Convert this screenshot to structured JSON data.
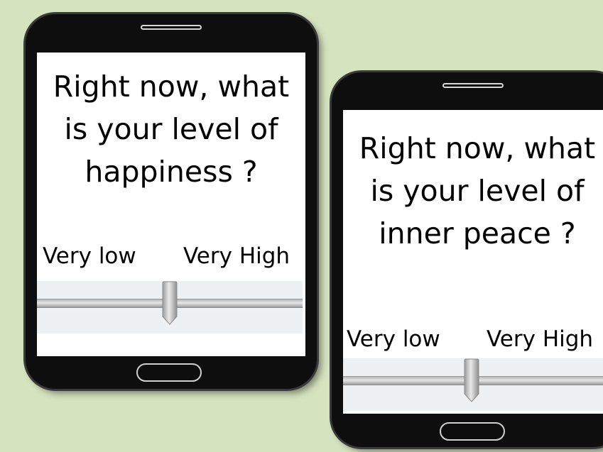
{
  "screens": [
    {
      "question_lines": [
        "Right now, what",
        "is your level of",
        "happiness ?"
      ],
      "scale": {
        "low_label": "Very low",
        "high_label": "Very High"
      },
      "slider_value": 0.5
    },
    {
      "question_lines": [
        "Right now, what",
        "is your level of",
        "inner peace ?"
      ],
      "scale": {
        "low_label": "Very low",
        "high_label": "Very High"
      },
      "slider_value": 0.46
    }
  ],
  "colors": {
    "background": "#d6e3bf",
    "phone_body": "#0e0e0e",
    "screen": "#ffffff",
    "slider_bg": "#eef1f4"
  }
}
